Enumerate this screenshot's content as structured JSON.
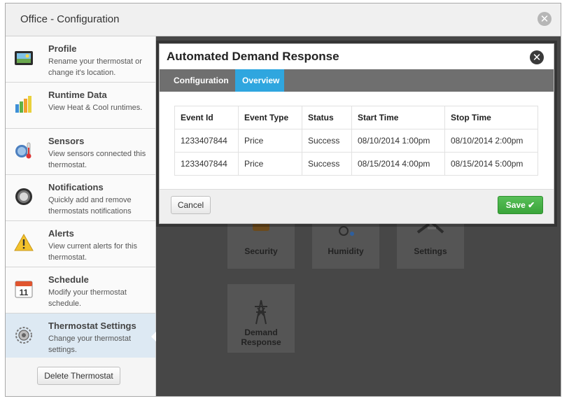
{
  "window": {
    "title": "Office - Configuration"
  },
  "sidebar": {
    "items": [
      {
        "title": "Profile",
        "desc": "Rename your thermostat or change it's location."
      },
      {
        "title": "Runtime Data",
        "desc": "View Heat & Cool runtimes."
      },
      {
        "title": "Sensors",
        "desc": "View sensors connected this thermostat."
      },
      {
        "title": "Notifications",
        "desc": "Quickly add and remove thermostats notifications"
      },
      {
        "title": "Alerts",
        "desc": "View current alerts for this thermostat."
      },
      {
        "title": "Schedule",
        "desc": "Modify your thermostat schedule.",
        "icon_text": "11"
      },
      {
        "title": "Thermostat Settings",
        "desc": "Change your thermostat settings."
      }
    ],
    "delete_label": "Delete Thermostat"
  },
  "tiles": [
    {
      "label": "Security"
    },
    {
      "label": "Humidity"
    },
    {
      "label": "Settings"
    },
    {
      "label": "Demand Response"
    }
  ],
  "modal": {
    "title": "Automated Demand Response",
    "tabs": [
      {
        "label": "Configuration"
      },
      {
        "label": "Overview"
      }
    ],
    "table": {
      "headers": [
        "Event Id",
        "Event Type",
        "Status",
        "Start Time",
        "Stop Time"
      ],
      "rows": [
        [
          "1233407844",
          "Price",
          "Success",
          "08/10/2014 1:00pm",
          "08/10/2014 2:00pm"
        ],
        [
          "1233407844",
          "Price",
          "Success",
          "08/15/2014 4:00pm",
          "08/15/2014 5:00pm"
        ]
      ]
    },
    "cancel_label": "Cancel",
    "save_label": "Save"
  },
  "icons": {
    "close": "close-icon",
    "save_check": "checkmark-icon"
  },
  "colors": {
    "active_tab": "#2fa6df",
    "save": "#45b045"
  }
}
